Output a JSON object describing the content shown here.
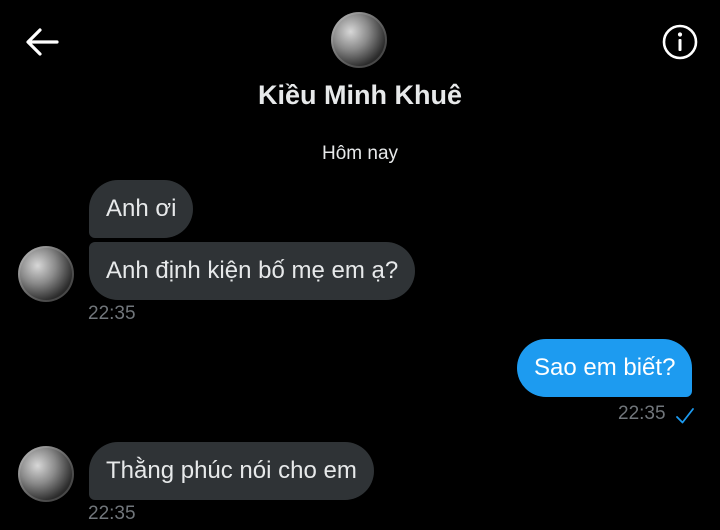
{
  "header": {
    "back_icon": "arrow-left-icon",
    "info_icon": "info-icon",
    "contact_name": "Kiều Minh Khuê"
  },
  "date_separator": "Hôm nay",
  "colors": {
    "background": "#000000",
    "incoming_bubble": "#2f3336",
    "outgoing_bubble": "#1d9bf0",
    "text": "#e7e9ea",
    "muted": "#71767b"
  },
  "messages": [
    {
      "direction": "incoming",
      "text": "Anh ơi"
    },
    {
      "direction": "incoming",
      "text": "Anh định kiện bố mẹ em ạ?",
      "time": "22:35"
    },
    {
      "direction": "outgoing",
      "text": "Sao em biết?",
      "time": "22:35",
      "status_icon": "sent-check-icon"
    },
    {
      "direction": "incoming",
      "text": "Thằng phúc nói cho em",
      "time": "22:35"
    }
  ]
}
